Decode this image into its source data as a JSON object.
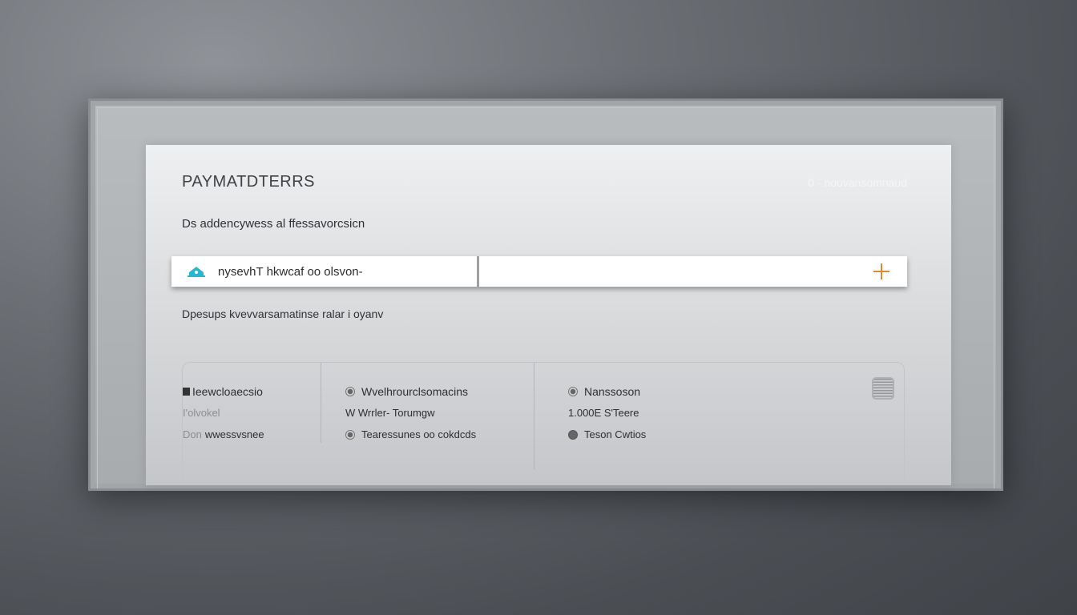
{
  "panel": {
    "title": "PAYMATDTERRS",
    "top_right": "0 · nouvansomnaud",
    "subtitle": "Ds   addencywess al ffessavorcsicn"
  },
  "input": {
    "icon": "home-icon",
    "value": "nysevhT hkwcaf oo olsvon-",
    "add_icon": "plus-icon"
  },
  "description": "Dpesups kvevvarsamatinse ralar i oyanv",
  "details": {
    "col1": {
      "heading": "Ieewcloaecsio",
      "line2": "I'olvokel",
      "line3_prefix": "Don",
      "line3": "wwessvsnee"
    },
    "col2": {
      "item1": "Wvelhrourclsomacins",
      "item2": "W  Wrrler- Torumgw",
      "item3": "Tearessunes oo cokdcds"
    },
    "col3": {
      "item1": "Nanssoson",
      "item2": "1.000E  S'Teere",
      "item3": "Teson Cwtios"
    },
    "corner_icon": "grid-keypad-icon"
  },
  "colors": {
    "accent_cyan": "#29b7cf",
    "accent_orange": "#e0892b"
  }
}
